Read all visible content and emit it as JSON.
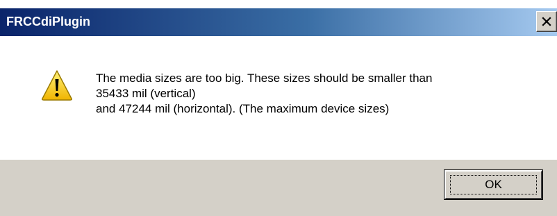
{
  "window": {
    "title": "FRCCdiPlugin",
    "close_icon": "close-icon"
  },
  "message": {
    "icon": "warning-icon",
    "lines": [
      "The media sizes are too big. These sizes should be smaller than",
      "35433 mil (vertical)",
      "and 47244 mil (horizontal). (The maximum device sizes)"
    ]
  },
  "buttons": {
    "ok_label": "OK"
  },
  "colors": {
    "titlebar_start": "#0a246a",
    "titlebar_end": "#a6caf0",
    "face": "#d4d0c8",
    "warning_yellow": "#f5c400"
  }
}
